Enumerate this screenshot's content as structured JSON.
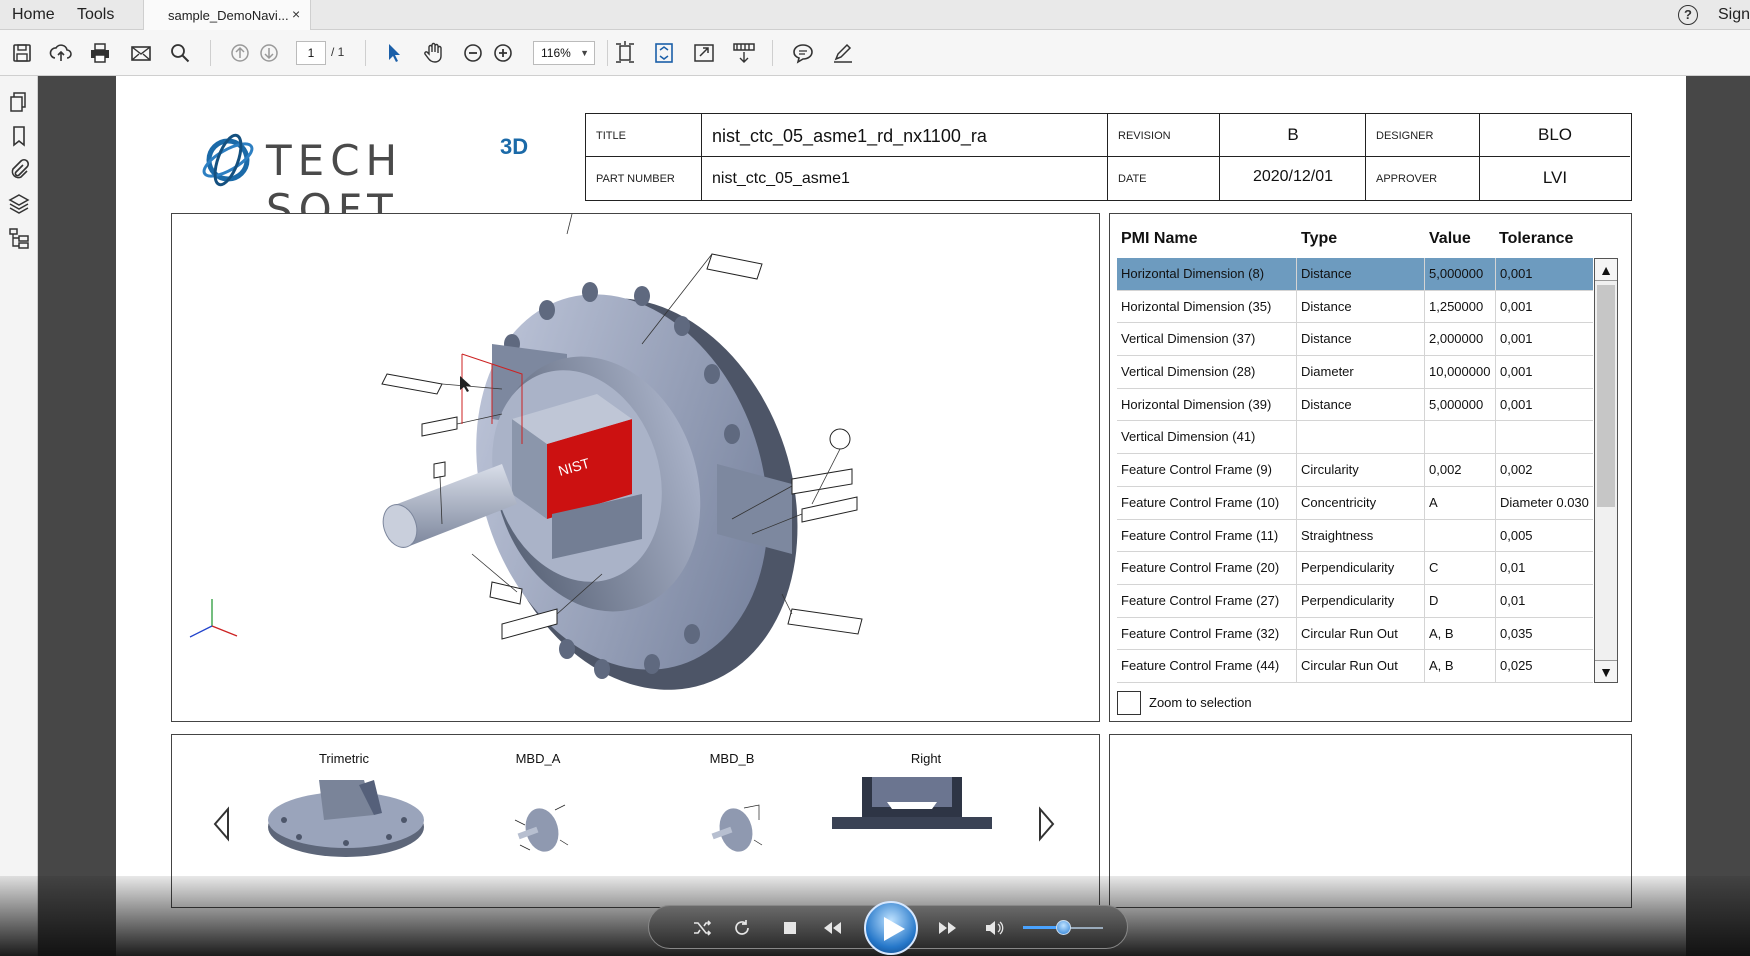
{
  "menubar": {
    "home": "Home",
    "tools": "Tools",
    "tab_title": "sample_DemoNavi...",
    "tab_close": "×",
    "help": "?",
    "sign_in": "Sign"
  },
  "toolbar": {
    "page_current": "1",
    "page_total": "/ 1",
    "zoom": "116%",
    "icons": [
      "save-icon",
      "upload-icon",
      "print-icon",
      "email-icon",
      "search-icon",
      "page-up-icon",
      "page-down-icon",
      "select-arrow-icon",
      "hand-icon",
      "zoom-out-icon",
      "zoom-in-icon",
      "fit-page-icon",
      "scroll-mode-icon",
      "fullscreen-icon",
      "export-icon",
      "comment-icon",
      "sign-pen-icon"
    ]
  },
  "leftpanel": {
    "icons": [
      "pages-icon",
      "bookmark-icon",
      "attachment-icon",
      "layers-icon",
      "model-tree-icon"
    ],
    "collapse": "◀"
  },
  "titleblock": {
    "logo_text": "TECH SOFT",
    "logo_sup": "3D",
    "title_label": "TITLE",
    "title_value": "nist_ctc_05_asme1_rd_nx1100_ra",
    "revision_label": "REVISION",
    "revision_value": "B",
    "designer_label": "DESIGNER",
    "designer_value": "BLO",
    "part_number_label": "PART NUMBER",
    "part_number_value": "nist_ctc_05_asme1",
    "date_label": "DATE",
    "date_value": "2020/12/01",
    "approver_label": "APPROVER",
    "approver_value": "LVI"
  },
  "viewport": {
    "part_label": "NIST"
  },
  "pmi": {
    "headers": [
      "PMI Name",
      "Type",
      "Value",
      "Tolerance"
    ],
    "selected_index": 0,
    "rows": [
      [
        "Horizontal Dimension (8)",
        "Distance",
        "5,000000",
        "0,001"
      ],
      [
        "Horizontal Dimension (35)",
        "Distance",
        "1,250000",
        "0,001"
      ],
      [
        "Vertical Dimension (37)",
        "Distance",
        "2,000000",
        "0,001"
      ],
      [
        "Vertical Dimension (28)",
        "Diameter",
        "10,000000",
        "0,001"
      ],
      [
        "Horizontal Dimension (39)",
        "Distance",
        "5,000000",
        "0,001"
      ],
      [
        "Vertical Dimension (41)",
        "",
        "",
        ""
      ],
      [
        "Feature Control Frame (9)",
        "Circularity",
        "0,002",
        "0,002"
      ],
      [
        "Feature Control Frame (10)",
        "Concentricity",
        "A",
        "Diameter 0.030"
      ],
      [
        "Feature Control Frame (11)",
        "Straightness",
        "",
        "0,005"
      ],
      [
        "Feature Control Frame (20)",
        "Perpendicularity",
        "C",
        "0,01"
      ],
      [
        "Feature Control Frame (27)",
        "Perpendicularity",
        "D",
        "0,01"
      ],
      [
        "Feature Control Frame (32)",
        "Circular Run Out",
        "A, B",
        "0,035"
      ],
      [
        "Feature Control Frame (44)",
        "Circular Run Out",
        "A, B",
        "0,025"
      ]
    ],
    "scroll_up": "▲",
    "scroll_down": "▼",
    "zoom_to_selection": "Zoom to selection"
  },
  "views": {
    "items": [
      "Trimetric",
      "MBD_A",
      "MBD_B",
      "Right"
    ]
  },
  "player": {
    "volume_level": 0.5,
    "icons": [
      "shuffle-icon",
      "repeat-icon",
      "stop-icon",
      "rewind-icon",
      "play-icon",
      "fast-forward-icon",
      "volume-icon"
    ]
  },
  "colors": {
    "selected_row": "#6d9bbf",
    "logo_blue": "#1b6aa8",
    "part_red": "#cc1111",
    "part_metal": "#9aa6bd"
  }
}
